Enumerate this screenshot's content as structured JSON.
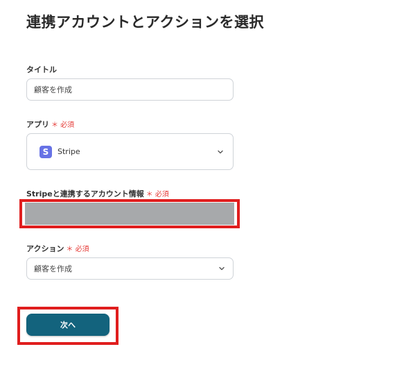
{
  "page": {
    "top_fragment": "~",
    "heading": "連携アカウントとアクションを選択"
  },
  "title_field": {
    "label": "タイトル",
    "value": "顧客を作成"
  },
  "app_field": {
    "label": "アプリ",
    "required": "＊ 必須",
    "app_icon_letter": "S",
    "app_name": "Stripe",
    "icon": "chevron-down-icon"
  },
  "account_field": {
    "label": "Stripeと連携するアカウント情報",
    "required": "＊ 必須"
  },
  "action_field": {
    "label": "アクション",
    "required": "＊ 必須",
    "value": "顧客を作成",
    "icon": "chevron-down-icon"
  },
  "next_button": {
    "label": "次へ"
  },
  "colors": {
    "accent": "#13637d",
    "required": "#e53935",
    "highlight": "#e01e1e",
    "stripe_icon": "#6772e5",
    "redacted": "#a7a9ab"
  }
}
